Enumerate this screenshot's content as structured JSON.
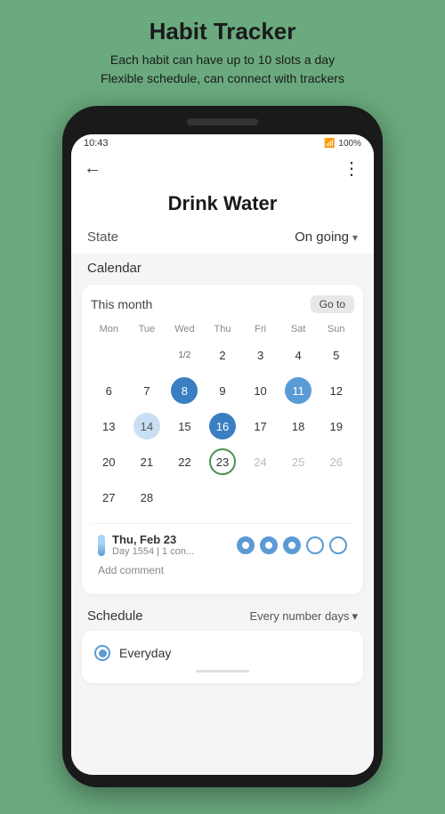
{
  "header": {
    "title": "Habit Tracker",
    "subtitle_line1": "Each habit can have up to 10 slots a day",
    "subtitle_line2": "Flexible schedule, can connect with trackers"
  },
  "status_bar": {
    "time": "10:43",
    "battery": "100%"
  },
  "page": {
    "title": "Drink Water",
    "back_label": "←",
    "more_label": "⋮"
  },
  "state": {
    "label": "State",
    "value": "On going",
    "dropdown_arrow": "▾"
  },
  "calendar": {
    "section_label": "Calendar",
    "month_label": "This month",
    "goto_label": "Go to",
    "day_headers": [
      "Mon",
      "Tue",
      "Wed",
      "Thu",
      "Fri",
      "Sat",
      "Sun"
    ],
    "rows": [
      [
        {
          "num": "",
          "type": "empty"
        },
        {
          "num": "",
          "type": "empty"
        },
        {
          "num": "1/2",
          "type": "text-small"
        },
        {
          "num": "2",
          "type": "normal"
        },
        {
          "num": "3",
          "type": "normal"
        },
        {
          "num": "4",
          "type": "normal"
        },
        {
          "num": "5",
          "type": "normal"
        }
      ],
      [
        {
          "num": "6",
          "type": "normal"
        },
        {
          "num": "7",
          "type": "normal"
        },
        {
          "num": "8",
          "type": "filled-dark"
        },
        {
          "num": "9",
          "type": "normal"
        },
        {
          "num": "10",
          "type": "normal"
        },
        {
          "num": "11",
          "type": "filled-blue"
        },
        {
          "num": "12",
          "type": "normal"
        }
      ],
      [
        {
          "num": "13",
          "type": "normal"
        },
        {
          "num": "14",
          "type": "partial-blue"
        },
        {
          "num": "15",
          "type": "normal"
        },
        {
          "num": "16",
          "type": "filled-dark"
        },
        {
          "num": "17",
          "type": "normal"
        },
        {
          "num": "18",
          "type": "normal"
        },
        {
          "num": "19",
          "type": "normal"
        }
      ],
      [
        {
          "num": "20",
          "type": "normal"
        },
        {
          "num": "21",
          "type": "normal"
        },
        {
          "num": "22",
          "type": "normal"
        },
        {
          "num": "23",
          "type": "today-outline"
        },
        {
          "num": "24",
          "type": "light-gray"
        },
        {
          "num": "25",
          "type": "light-gray"
        },
        {
          "num": "26",
          "type": "light-gray"
        }
      ],
      [
        {
          "num": "27",
          "type": "normal"
        },
        {
          "num": "28",
          "type": "normal"
        },
        {
          "num": "",
          "type": "empty"
        },
        {
          "num": "",
          "type": "empty"
        },
        {
          "num": "",
          "type": "empty"
        },
        {
          "num": "",
          "type": "empty"
        },
        {
          "num": "",
          "type": "empty"
        }
      ]
    ],
    "detail": {
      "date": "Thu, Feb 23",
      "sub": "Day 1554 | 1 con...",
      "dots": [
        "filled",
        "filled",
        "filled",
        "empty",
        "empty"
      ],
      "add_comment": "Add comment"
    }
  },
  "schedule": {
    "label": "Schedule",
    "value": "Every number days",
    "dropdown_arrow": "▾",
    "options": [
      {
        "label": "Everyday",
        "selected": true
      }
    ]
  }
}
